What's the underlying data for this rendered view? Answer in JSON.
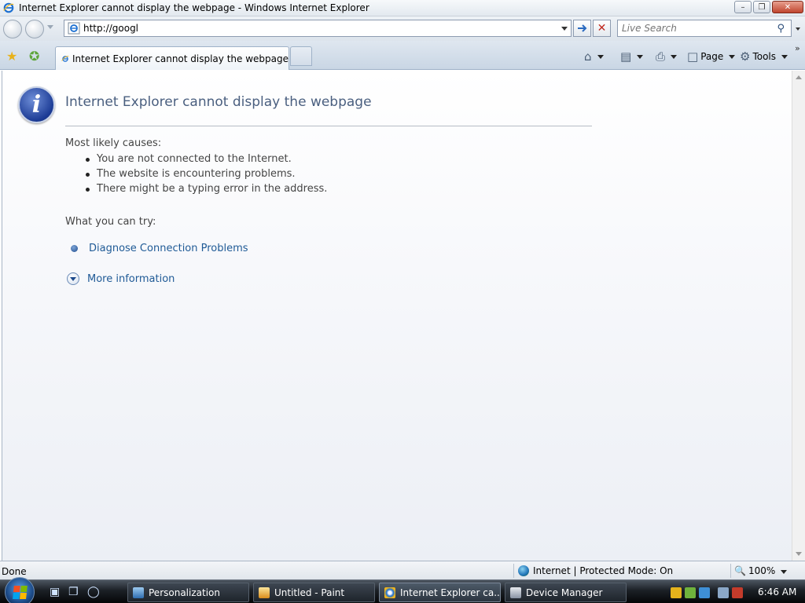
{
  "window": {
    "title": "Internet Explorer cannot display the webpage - Windows Internet Explorer"
  },
  "address_bar": {
    "url": "http://googl",
    "search_placeholder": "Live Search"
  },
  "tabs": [
    {
      "label": "Internet Explorer cannot display the webpage"
    }
  ],
  "command_bar": {
    "page_label": "Page",
    "tools_label": "Tools"
  },
  "page": {
    "heading": "Internet Explorer cannot display the webpage",
    "causes_title": "Most likely causes:",
    "causes": [
      "You are not connected to the Internet.",
      "The website is encountering problems.",
      "There might be a typing error in the address."
    ],
    "try_title": "What you can try:",
    "diagnose_link": "Diagnose Connection Problems",
    "more_info_link": "More information"
  },
  "status_bar": {
    "status": "Done",
    "zone": "Internet | Protected Mode: On",
    "zoom": "100%"
  },
  "taskbar": {
    "tasks": [
      {
        "label": "Personalization"
      },
      {
        "label": "Untitled - Paint"
      },
      {
        "label": "Internet Explorer ca..."
      },
      {
        "label": "Device Manager"
      }
    ],
    "clock": "6:46 AM"
  },
  "colors": {
    "link": "#1f5a96",
    "heading": "#4a5f7f",
    "info_icon": "#1c3b95"
  },
  "icons": {
    "info": "info-icon",
    "favorites": "star-icon",
    "add_favorites": "add-favorites-icon",
    "home": "home-icon",
    "feeds": "feeds-icon",
    "print": "print-icon",
    "tools": "gear-icon",
    "go": "arrow-right-icon",
    "stop": "close-icon"
  }
}
